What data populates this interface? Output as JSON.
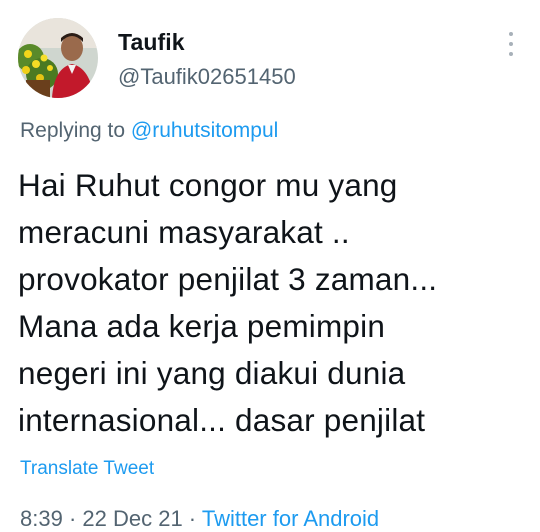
{
  "author": {
    "name": "Taufik",
    "handle": "@Taufik02651450",
    "avatar_icon": "profile-photo"
  },
  "reply": {
    "prefix": "Replying to ",
    "mention": "@ruhutsitompul"
  },
  "tweet": {
    "lines": [
      "Hai Ruhut congor mu yang",
      "meracuni masyarakat ..",
      "provokator penjilat 3 zaman...",
      "Mana ada kerja pemimpin",
      "negeri ini yang diakui dunia",
      "internasional... dasar penjilat"
    ]
  },
  "translate_label": "Translate Tweet",
  "meta": {
    "time": "8:39",
    "separator_1": " · ",
    "date": "22 Dec 21",
    "separator_2": " · ",
    "source": "Twitter for Android"
  },
  "menu_icon": "more-vertical-icon",
  "colors": {
    "accent": "#1d9bf0",
    "secondary_text": "#536471",
    "primary_text": "#0f1419"
  }
}
